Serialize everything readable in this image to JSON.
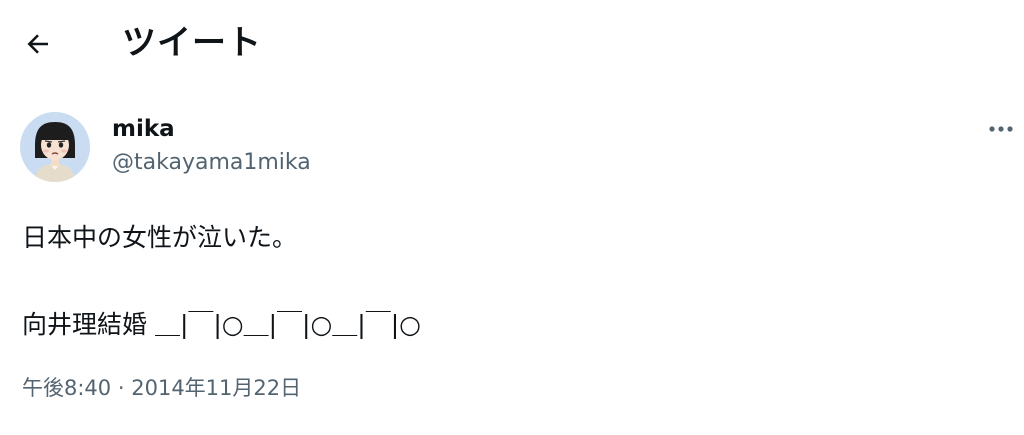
{
  "header": {
    "back_icon": "arrow-left-icon",
    "title": "ツイート"
  },
  "author": {
    "avatar_icon": "avatar-illustration",
    "display_name": "mika",
    "handle": "@takayama1mika",
    "more_icon": "more-horizontal-icon"
  },
  "tweet": {
    "lines": [
      "日本中の女性が泣いた。",
      "向井理結婚 ＿|￣|○＿|￣|○＿|￣|○"
    ],
    "time": "午後8:40",
    "separator": "·",
    "date": "2014年11月22日"
  },
  "colors": {
    "text_primary": "#0f1419",
    "text_secondary": "#536471",
    "avatar_bg": "#c9dcf2"
  }
}
